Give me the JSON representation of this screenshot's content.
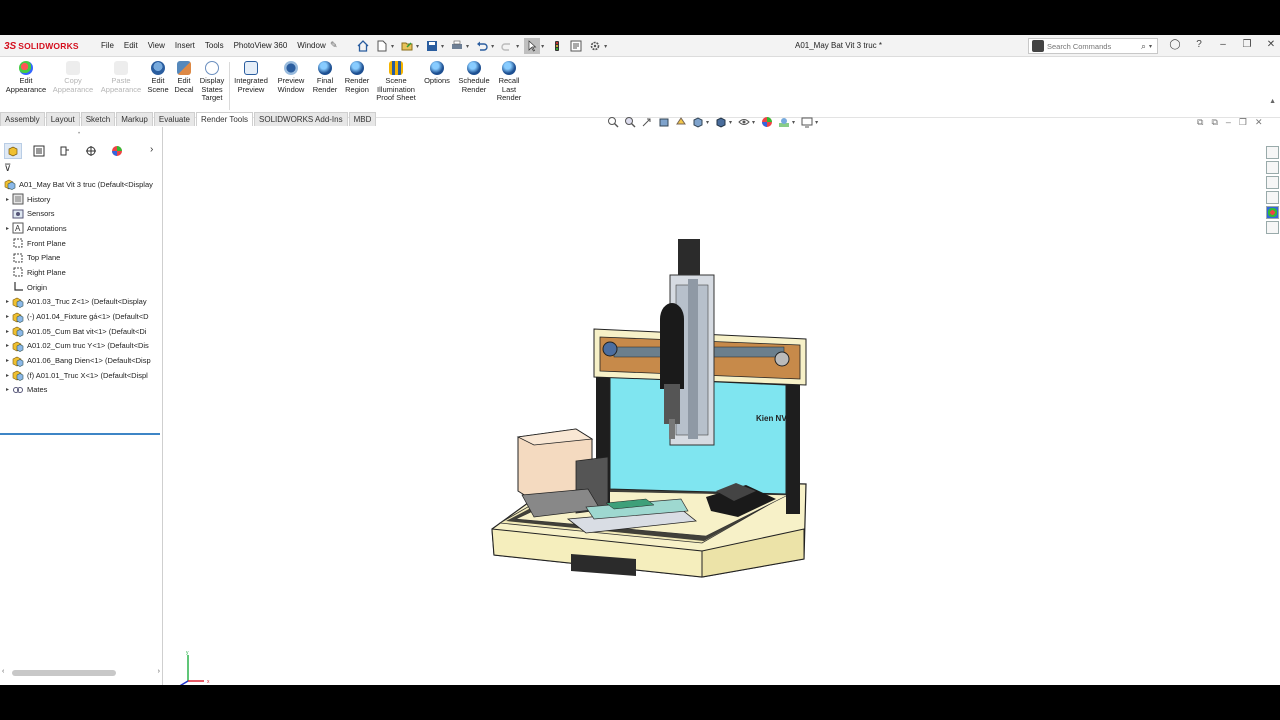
{
  "app": {
    "brand": "SOLIDWORKS",
    "document_title": "A01_May Bat Vit 3 truc *"
  },
  "menu": [
    "File",
    "Edit",
    "View",
    "Insert",
    "Tools",
    "PhotoView 360",
    "Window"
  ],
  "search": {
    "placeholder": "Search Commands"
  },
  "ribbon": {
    "buttons": [
      {
        "label": "Edit Appearance",
        "icon": "edit-appearance-icon",
        "enabled": true
      },
      {
        "label": "Copy Appearance",
        "icon": "copy-appearance-icon",
        "enabled": false
      },
      {
        "label": "Paste Appearance",
        "icon": "paste-appearance-icon",
        "enabled": false
      },
      {
        "label": "Edit Scene",
        "icon": "edit-scene-icon",
        "enabled": true
      },
      {
        "label": "Edit Decal",
        "icon": "edit-decal-icon",
        "enabled": true
      },
      {
        "label": "Display States Target",
        "icon": "display-states-icon",
        "enabled": true
      },
      {
        "label": "Integrated Preview",
        "icon": "integrated-preview-icon",
        "enabled": true
      },
      {
        "label": "Preview Window",
        "icon": "preview-window-icon",
        "enabled": true
      },
      {
        "label": "Final Render",
        "icon": "final-render-icon",
        "enabled": true
      },
      {
        "label": "Render Region",
        "icon": "render-region-icon",
        "enabled": true
      },
      {
        "label": "Scene Illumination Proof Sheet",
        "icon": "scene-illumination-icon",
        "enabled": true
      },
      {
        "label": "Options",
        "icon": "options-icon",
        "enabled": true
      },
      {
        "label": "Schedule Render",
        "icon": "schedule-render-icon",
        "enabled": true
      },
      {
        "label": "Recall Last Render",
        "icon": "recall-render-icon",
        "enabled": true
      }
    ]
  },
  "tabs": [
    {
      "label": "Assembly",
      "active": false
    },
    {
      "label": "Layout",
      "active": false
    },
    {
      "label": "Sketch",
      "active": false
    },
    {
      "label": "Markup",
      "active": false
    },
    {
      "label": "Evaluate",
      "active": false
    },
    {
      "label": "Render Tools",
      "active": true
    },
    {
      "label": "SOLIDWORKS Add-Ins",
      "active": false
    },
    {
      "label": "MBD",
      "active": false
    }
  ],
  "tree": {
    "root": "A01_May Bat Vit 3 truc  (Default<Display",
    "items": [
      {
        "label": "History",
        "expandable": true,
        "icon": "history-icon"
      },
      {
        "label": "Sensors",
        "expandable": false,
        "icon": "sensors-icon"
      },
      {
        "label": "Annotations",
        "expandable": true,
        "icon": "annotations-icon"
      },
      {
        "label": "Front Plane",
        "expandable": false,
        "icon": "plane-icon"
      },
      {
        "label": "Top Plane",
        "expandable": false,
        "icon": "plane-icon"
      },
      {
        "label": "Right Plane",
        "expandable": false,
        "icon": "plane-icon"
      },
      {
        "label": "Origin",
        "expandable": false,
        "icon": "origin-icon"
      },
      {
        "label": "A01.03_Truc Z<1> (Default<Display",
        "expandable": true,
        "icon": "component-icon"
      },
      {
        "label": "(-) A01.04_Fixture gá<1> (Default<D",
        "expandable": true,
        "icon": "component-icon"
      },
      {
        "label": "A01.05_Cum Bat vit<1> (Default<Di",
        "expandable": true,
        "icon": "component-icon"
      },
      {
        "label": "A01.02_Cum truc Y<1> (Default<Dis",
        "expandable": true,
        "icon": "component-icon"
      },
      {
        "label": "A01.06_Bang Dien<1> (Default<Disp",
        "expandable": true,
        "icon": "component-icon"
      },
      {
        "label": "(f) A01.01_Truc X<1> (Default<Displ",
        "expandable": true,
        "icon": "component-icon"
      },
      {
        "label": "Mates",
        "expandable": true,
        "icon": "mates-icon"
      }
    ]
  },
  "model": {
    "backpanel_text": "Kien NV"
  },
  "triad": {
    "y": "y",
    "x": "x"
  },
  "colors": {
    "brand": "#d40f1e",
    "panel_cyan": "#7fe5f0",
    "base_cream": "#f7f1c8",
    "frame_dark": "#1e1e1e",
    "selection_blue": "#3d85c6"
  }
}
